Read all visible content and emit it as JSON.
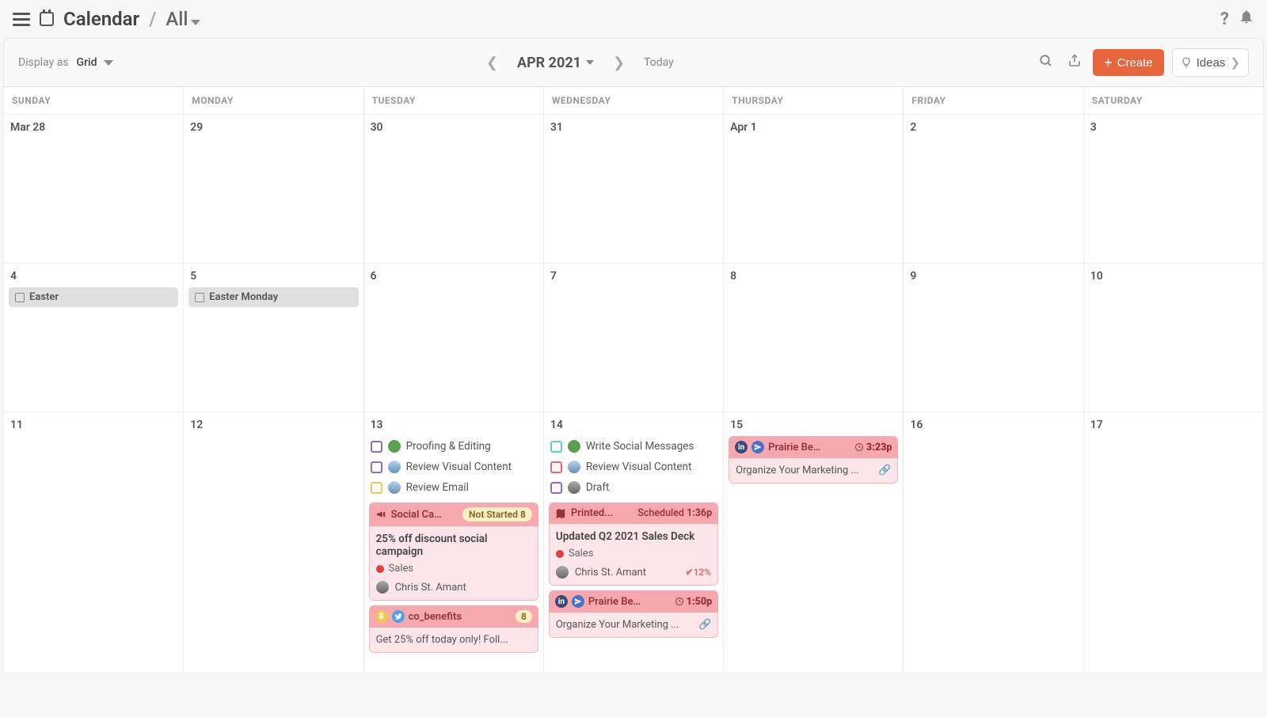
{
  "header": {
    "app": "Calendar",
    "sub": "All"
  },
  "toolbar": {
    "displayAsLabel": "Display as",
    "displayMode": "Grid",
    "month": "APR 2021",
    "today": "Today",
    "create": "Create",
    "ideas": "Ideas"
  },
  "days": [
    "SUNDAY",
    "MONDAY",
    "TUESDAY",
    "WEDNESDAY",
    "THURSDAY",
    "FRIDAY",
    "SATURDAY"
  ],
  "dates": {
    "r1": [
      "Mar 28",
      "29",
      "30",
      "31",
      "Apr 1",
      "2",
      "3"
    ],
    "r2": [
      "4",
      "5",
      "6",
      "7",
      "8",
      "9",
      "10"
    ],
    "r3": [
      "11",
      "12",
      "13",
      "14",
      "15",
      "16",
      "17"
    ]
  },
  "holidays": {
    "easter": "Easter",
    "easterMon": "Easter Monday"
  },
  "tu13": {
    "t1": "Proofing & Editing",
    "t2": "Review Visual Content",
    "t3": "Review Email",
    "card": {
      "type": "Social Ca...",
      "badge": "Not Started 8",
      "title": "25% off discount social campaign",
      "cat": "Sales",
      "assignee": "Chris St. Amant"
    },
    "mini": {
      "name": "co_benefits",
      "count": "8",
      "body": "Get 25% off today only! Foll..."
    }
  },
  "we14": {
    "t1": "Write Social Messages",
    "t2": "Review Visual Content",
    "t3": "Draft",
    "card": {
      "type": "Printed...",
      "status": "Scheduled",
      "time": "1:36p",
      "title": "Updated Q2 2021 Sales Deck",
      "cat": "Sales",
      "assignee": "Chris St. Amant",
      "pct": "12%"
    },
    "mini": {
      "name": "Prairie Ben...",
      "time": "1:50p",
      "body": "Organize Your Marketing ..."
    }
  },
  "th15": {
    "mini": {
      "name": "Prairie Ben...",
      "time": "3:23p",
      "body": "Organize Your Marketing ..."
    }
  }
}
